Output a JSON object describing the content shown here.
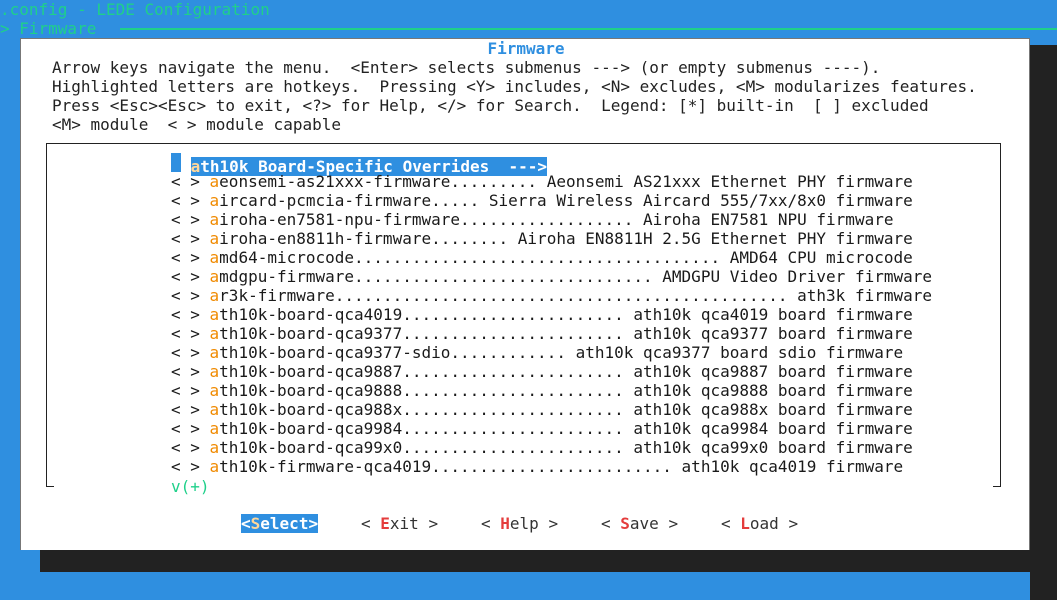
{
  "header": {
    "title": ".config - LEDE Configuration",
    "breadcrumb": "> Firmware"
  },
  "dialog": {
    "title": "Firmware",
    "help_lines": [
      "Arrow keys navigate the menu.  <Enter> selects submenus ---> (or empty submenus ----).",
      "Highlighted letters are hotkeys.  Pressing <Y> includes, <N> excludes, <M> modularizes features.",
      "Press <Esc><Esc> to exit, <?> for Help, </> for Search.  Legend: [*] built-in  [ ] excluded",
      "<M> module  < > module capable"
    ]
  },
  "menu": {
    "items": [
      {
        "prefix": "  ",
        "hotkey": "a",
        "rest": "th10k Board-Specific Overrides  --->",
        "selected": true
      },
      {
        "prefix": "< > ",
        "hotkey": "a",
        "rest": "eonsemi-as21xxx-firmware......... Aeonsemi AS21xxx Ethernet PHY firmware"
      },
      {
        "prefix": "< > ",
        "hotkey": "a",
        "rest": "ircard-pcmcia-firmware..... Sierra Wireless Aircard 555/7xx/8x0 firmware"
      },
      {
        "prefix": "< > ",
        "hotkey": "a",
        "rest": "iroha-en7581-npu-firmware.................. Airoha EN7581 NPU firmware"
      },
      {
        "prefix": "< > ",
        "hotkey": "a",
        "rest": "iroha-en8811h-firmware........ Airoha EN8811H 2.5G Ethernet PHY firmware"
      },
      {
        "prefix": "< > ",
        "hotkey": "a",
        "rest": "md64-microcode...................................... AMD64 CPU microcode"
      },
      {
        "prefix": "< > ",
        "hotkey": "a",
        "rest": "mdgpu-firmware............................... AMDGPU Video Driver firmware"
      },
      {
        "prefix": "< > ",
        "hotkey": "a",
        "rest": "r3k-firmware............................................... ath3k firmware"
      },
      {
        "prefix": "< > ",
        "hotkey": "a",
        "rest": "th10k-board-qca4019....................... ath10k qca4019 board firmware"
      },
      {
        "prefix": "< > ",
        "hotkey": "a",
        "rest": "th10k-board-qca9377....................... ath10k qca9377 board firmware"
      },
      {
        "prefix": "< > ",
        "hotkey": "a",
        "rest": "th10k-board-qca9377-sdio............ ath10k qca9377 board sdio firmware"
      },
      {
        "prefix": "< > ",
        "hotkey": "a",
        "rest": "th10k-board-qca9887....................... ath10k qca9887 board firmware"
      },
      {
        "prefix": "< > ",
        "hotkey": "a",
        "rest": "th10k-board-qca9888....................... ath10k qca9888 board firmware"
      },
      {
        "prefix": "< > ",
        "hotkey": "a",
        "rest": "th10k-board-qca988x....................... ath10k qca988x board firmware"
      },
      {
        "prefix": "< > ",
        "hotkey": "a",
        "rest": "th10k-board-qca9984....................... ath10k qca9984 board firmware"
      },
      {
        "prefix": "< > ",
        "hotkey": "a",
        "rest": "th10k-board-qca99x0....................... ath10k qca99x0 board firmware"
      },
      {
        "prefix": "< > ",
        "hotkey": "a",
        "rest": "th10k-firmware-qca4019......................... ath10k qca4019 firmware"
      }
    ],
    "more_indicator": "v(+)"
  },
  "buttons": [
    {
      "pre": "<",
      "hotkey": "S",
      "post": "elect>",
      "active": true
    },
    {
      "pre": "< ",
      "hotkey": "E",
      "post": "xit >"
    },
    {
      "pre": "< ",
      "hotkey": "H",
      "post": "elp >"
    },
    {
      "pre": "< ",
      "hotkey": "S",
      "post": "ave >"
    },
    {
      "pre": "< ",
      "hotkey": "L",
      "post": "oad >"
    }
  ]
}
